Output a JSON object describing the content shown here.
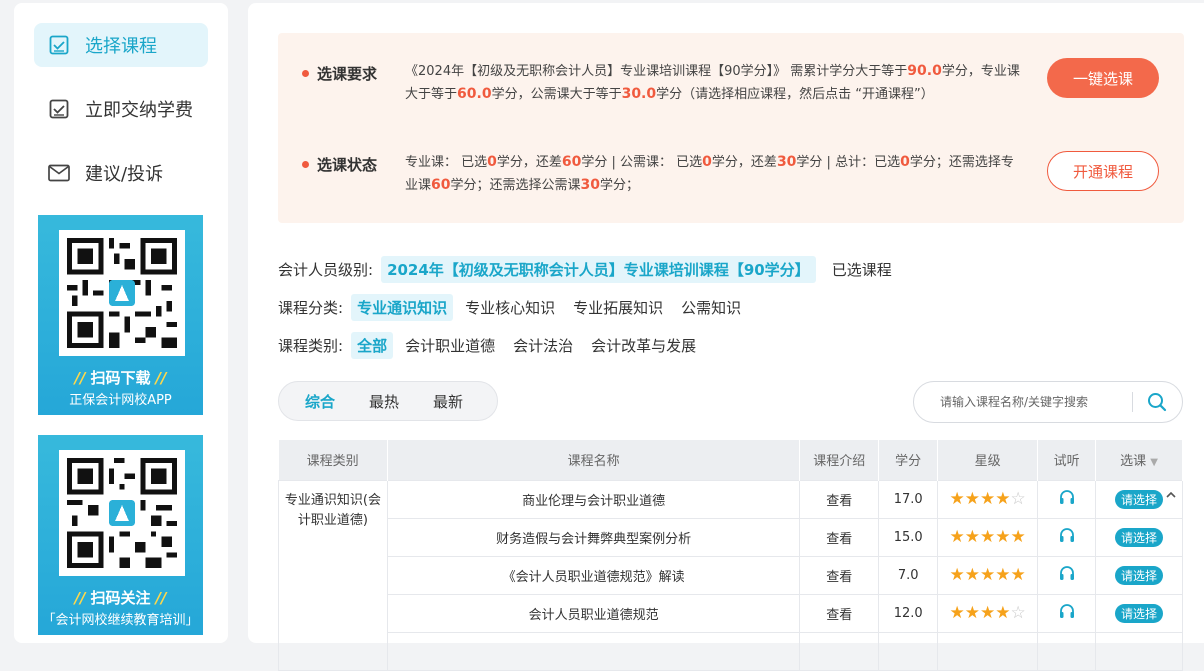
{
  "sidebar": {
    "items": [
      {
        "label": "选择课程",
        "icon": "checklist-icon",
        "active": true
      },
      {
        "label": "立即交纳学费",
        "icon": "checklist-icon",
        "active": false
      },
      {
        "label": "建议/投诉",
        "icon": "mail-icon",
        "active": false
      }
    ],
    "promos": [
      {
        "slash": "//",
        "title": "扫码下载",
        "subtitle": "正保会计网校APP"
      },
      {
        "slash": "//",
        "title": "扫码关注",
        "subtitle": "「会计网校继续教育培训」"
      }
    ]
  },
  "requirements": {
    "req_label": "选课要求",
    "req_text_1": "《2024年【初级及无职称会计人员】专业课培训课程【90学分】》 需累计学分大于等于",
    "req_total": "90.0",
    "req_text_2": "学分，专业课大于等于",
    "req_prof": "60.0",
    "req_text_3": "学分，公需课大于等于",
    "req_public": "30.0",
    "req_text_4": "学分（请选择相应课程，然后点击 “开通课程”）",
    "status_label": "选课状态",
    "st_1": "专业课：  已选",
    "st_prof_sel": "0",
    "st_2": "学分，还差",
    "st_prof_left": "60",
    "st_3": "学分 | 公需课：  已选",
    "st_pub_sel": "0",
    "st_4": "学分，还差",
    "st_pub_left": "30",
    "st_5": "学分 | 总计：已选",
    "st_total_sel": "0",
    "st_6": "学分；还需选择专业课",
    "st_need_prof": "60",
    "st_7": "学分；还需选择公需课",
    "st_need_pub": "30",
    "st_8": "学分；",
    "btn_one_click": "一键选课",
    "btn_open": "开通课程"
  },
  "filters": {
    "level_label": "会计人员级别:",
    "level_selected": "2024年【初级及无职称会计人员】专业课培训课程【90学分】",
    "level_other": "已选课程",
    "category_label": "课程分类:",
    "categories": [
      "专业通识知识",
      "专业核心知识",
      "专业拓展知识",
      "公需知识"
    ],
    "type_label": "课程类别:",
    "types": [
      "全部",
      "会计职业道德",
      "会计法治",
      "会计改革与发展"
    ]
  },
  "sort": {
    "options": [
      "综合",
      "最热",
      "最新"
    ],
    "active": 0
  },
  "search": {
    "placeholder": "请输入课程名称/关键字搜索"
  },
  "table": {
    "headers": [
      "课程类别",
      "课程名称",
      "课程介绍",
      "学分",
      "星级",
      "试听",
      "选课"
    ],
    "category": "专业通识知识(会计职业道德)",
    "rows": [
      {
        "name": "商业伦理与会计职业道德",
        "intro": "查看",
        "credit": "17.0",
        "stars": 4,
        "action": "请选择"
      },
      {
        "name": "财务造假与会计舞弊典型案例分析",
        "intro": "查看",
        "credit": "15.0",
        "stars": 5,
        "action": "请选择"
      },
      {
        "name": "《会计人员职业道德规范》解读",
        "intro": "查看",
        "credit": "7.0",
        "stars": 5,
        "action": "请选择"
      },
      {
        "name": "会计人员职业道德规范",
        "intro": "查看",
        "credit": "12.0",
        "stars": 4,
        "action": "请选择"
      }
    ]
  },
  "colors": {
    "accent": "#1aa6c9",
    "orange": "#f05a3e",
    "star": "#f6a21b"
  }
}
